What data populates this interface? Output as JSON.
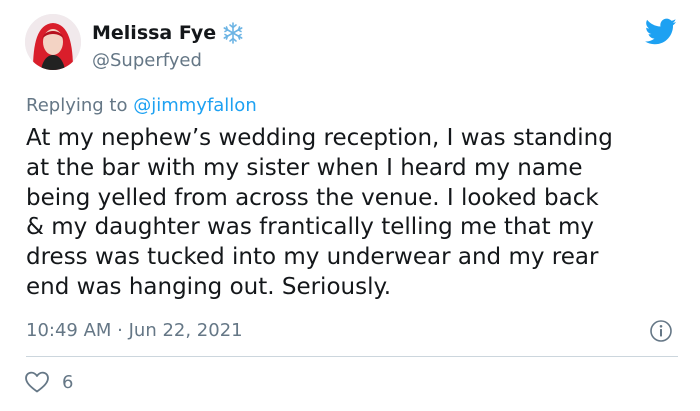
{
  "tweet": {
    "display_name": "Melissa Fye",
    "display_name_emoji": "snowflake-icon",
    "handle": "@Superfyed",
    "replying_prefix": "Replying to",
    "replying_mention": "@jimmyfallon",
    "body_lines": [
      "At my nephew’s wedding reception, I was standing",
      "at the bar with my sister when I heard my name",
      "being yelled from across the venue. I looked back",
      "& my daughter was frantically telling me that my",
      "dress was tucked into my underwear and my rear",
      "end was hanging out. Seriously."
    ],
    "timestamp": "10:49 AM · Jun 22, 2021",
    "like_count": "6"
  },
  "icons": {
    "brand": "twitter-bird-icon",
    "info": "info-icon",
    "like": "heart-icon"
  },
  "colors": {
    "brand_blue": "#1da1f2",
    "text": "#14171a",
    "secondary_text": "#657786",
    "divider": "#ccd6dd",
    "avatar_hair": "#d91e2b"
  }
}
